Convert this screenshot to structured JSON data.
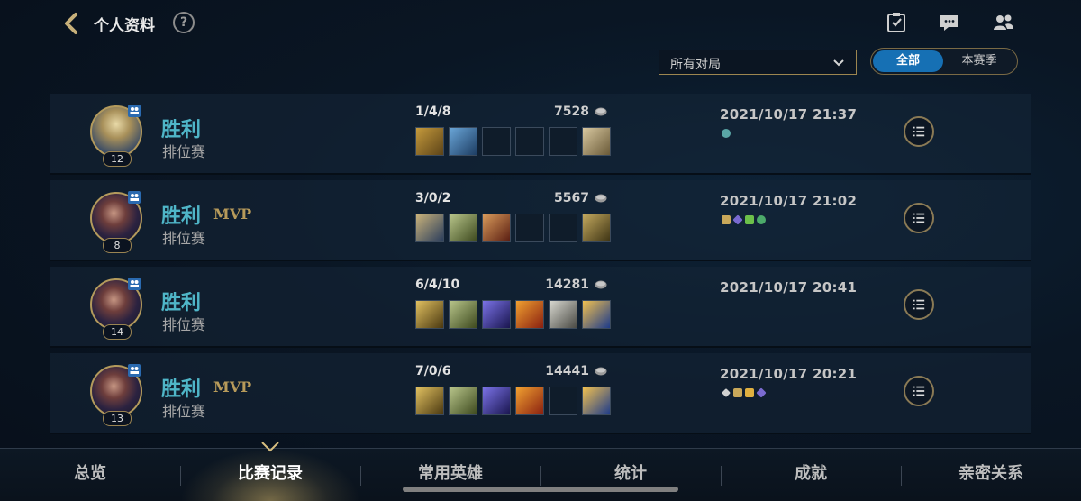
{
  "header": {
    "title": "个人资料",
    "help": "?"
  },
  "filters": {
    "match_type": "所有对局",
    "segments": [
      "全部",
      "本赛季"
    ],
    "active_segment": "全部"
  },
  "matches": [
    {
      "level": "12",
      "result": "胜利",
      "mvp": "",
      "mode": "排位赛",
      "kda": "1/4/8",
      "gold": "7528",
      "date": "2021/10/17 21:37"
    },
    {
      "level": "8",
      "result": "胜利",
      "mvp": "MVP",
      "mode": "排位赛",
      "kda": "3/0/2",
      "gold": "5567",
      "date": "2021/10/17 21:02"
    },
    {
      "level": "14",
      "result": "胜利",
      "mvp": "",
      "mode": "排位赛",
      "kda": "6/4/10",
      "gold": "14281",
      "date": "2021/10/17 20:41"
    },
    {
      "level": "13",
      "result": "胜利",
      "mvp": "MVP",
      "mode": "排位赛",
      "kda": "7/0/6",
      "gold": "14441",
      "date": "2021/10/17 20:21"
    }
  ],
  "nav": {
    "tabs": [
      "总览",
      "比赛记录",
      "常用英雄",
      "统计",
      "成就",
      "亲密关系"
    ],
    "active": "比赛记录"
  },
  "colors": {
    "win": "#4fb6c8",
    "gold_accent": "#b79a5a",
    "active_segment": "#1670b4"
  },
  "icons": {
    "back": "chevron-left-icon",
    "top_right": [
      "checklist-icon",
      "chat-bubble-icon",
      "friends-icon"
    ],
    "detail": "list-icon",
    "gold": "coin-icon"
  }
}
